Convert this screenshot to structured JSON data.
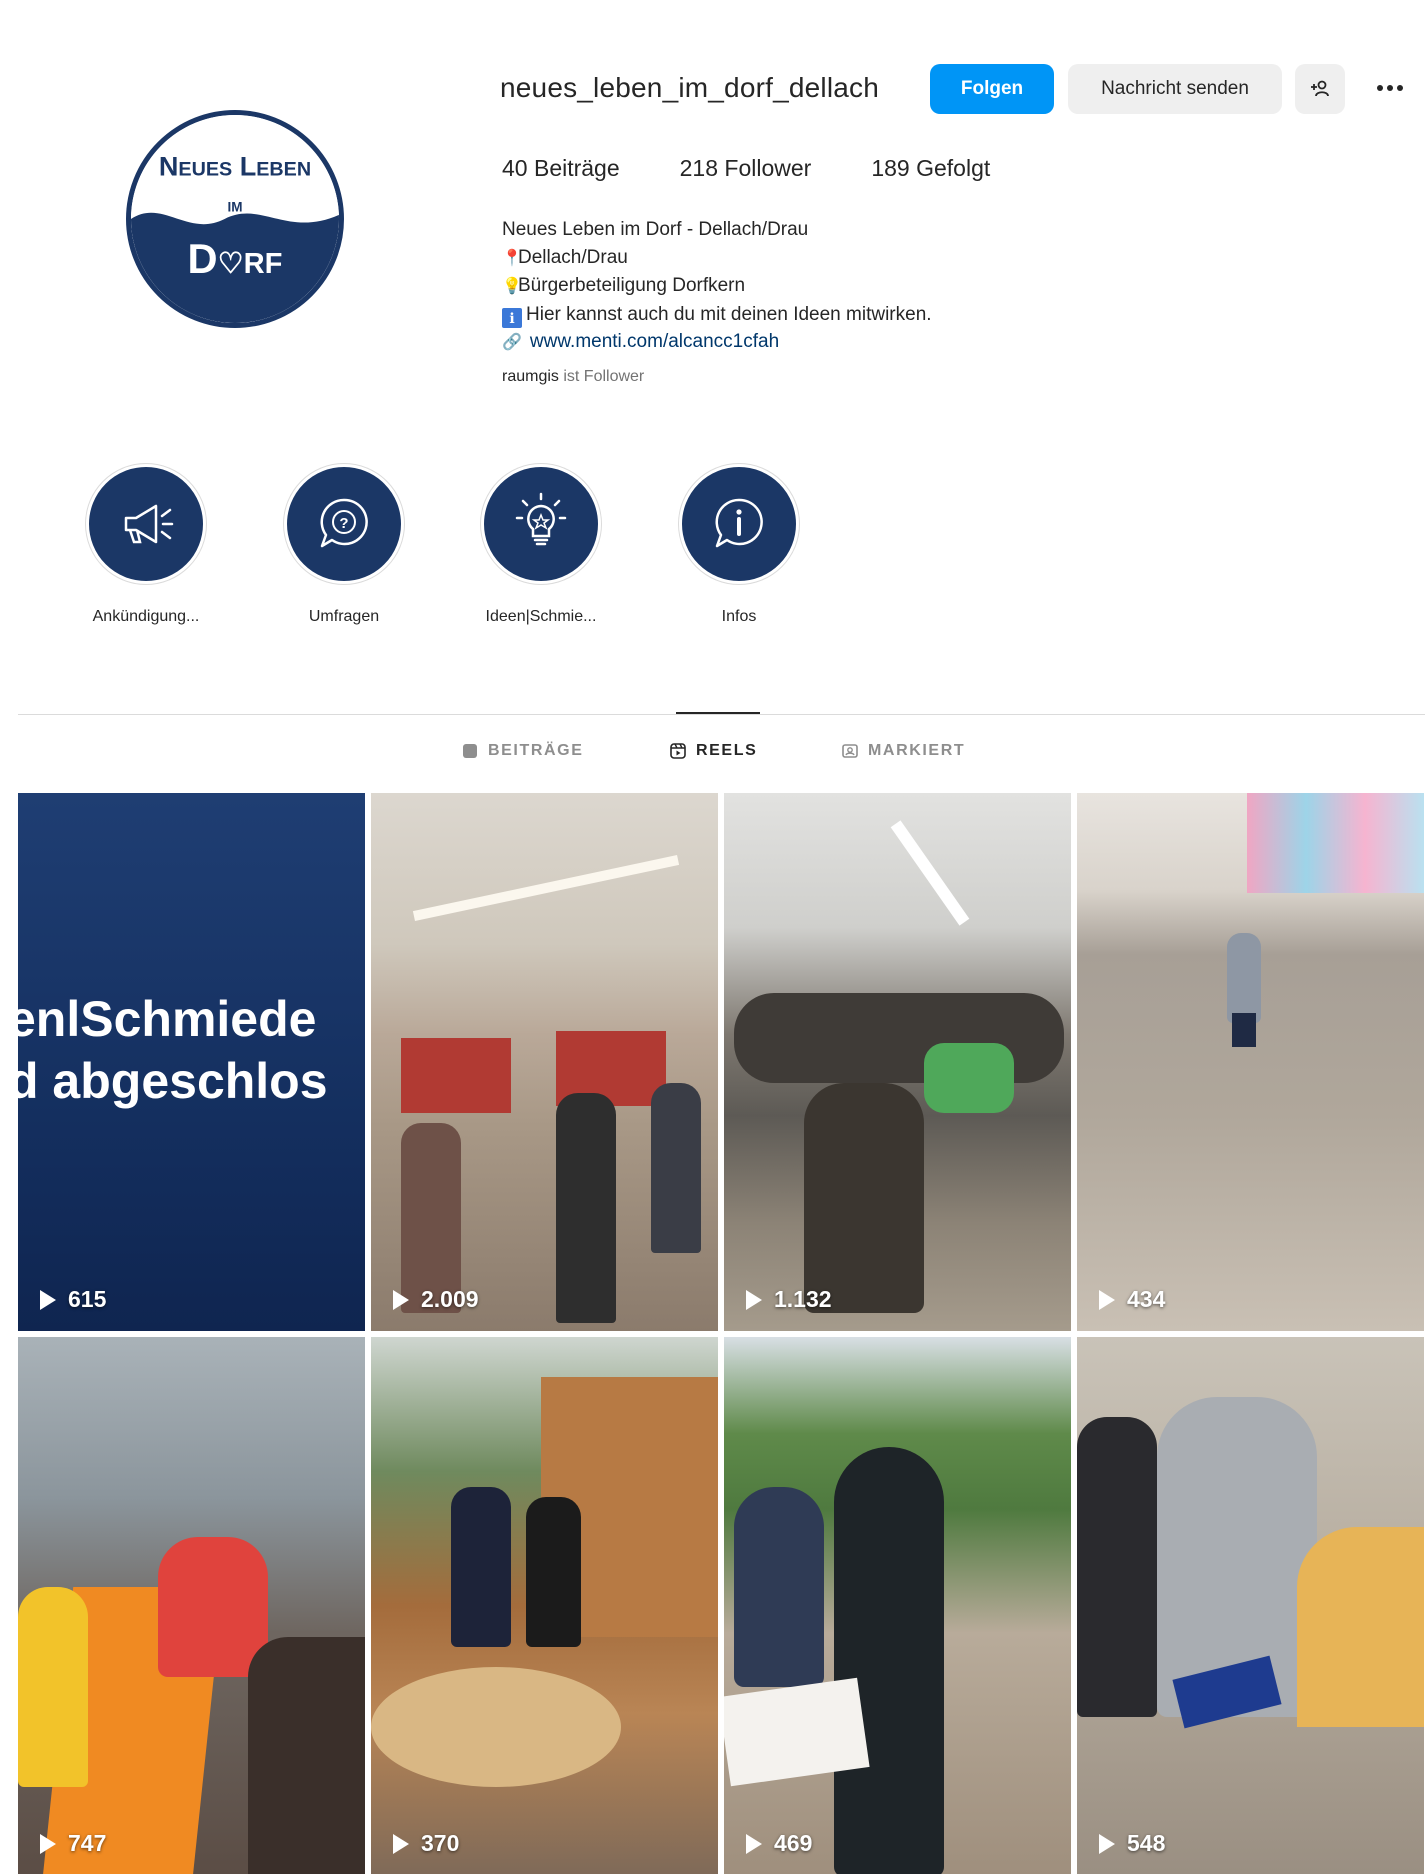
{
  "profile": {
    "username": "neues_leben_im_dorf_dellach",
    "follow_label": "Folgen",
    "message_label": "Nachricht senden",
    "suggest_icon": "person-plus-icon",
    "more_icon": "more-dots-icon",
    "avatar_text_line1": "Neues Leben",
    "avatar_text_line2": "im",
    "avatar_text_line3": "Dorf",
    "stats": {
      "posts": "40 Beiträge",
      "followers": "218 Follower",
      "following": "189 Gefolgt"
    },
    "bio": {
      "name": "Neues Leben im Dorf - Dellach/Drau",
      "line1": "Dellach/Drau",
      "line2": "Bürgerbeteiligung Dorfkern",
      "line3": "Hier kannst auch du mit deinen Ideen mitwirken.",
      "link": "www.menti.com/alcancc1cfah"
    },
    "followed_by_user": "raumgis",
    "followed_by_suffix": " ist Follower"
  },
  "highlights": [
    {
      "label": "Ankündigung...",
      "icon": "megaphone-icon"
    },
    {
      "label": "Umfragen",
      "icon": "question-bubble-icon"
    },
    {
      "label": "Ideen|Schmie...",
      "icon": "lightbulb-icon"
    },
    {
      "label": "Infos",
      "icon": "info-bubble-icon"
    }
  ],
  "tabs": {
    "posts": "BEITRÄGE",
    "reels": "REELS",
    "tagged": "MARKIERT"
  },
  "reels": [
    {
      "views": "615",
      "overlay_line1": "enlSchmiede",
      "overlay_line2": "d abgeschlos"
    },
    {
      "views": "2.009"
    },
    {
      "views": "1.132"
    },
    {
      "views": "434"
    },
    {
      "views": "747"
    },
    {
      "views": "370"
    },
    {
      "views": "469"
    },
    {
      "views": "548"
    }
  ],
  "colors": {
    "primary_button": "#0095f6",
    "brand_navy": "#1b3766",
    "text": "#262626",
    "muted": "#8e8e8e"
  }
}
